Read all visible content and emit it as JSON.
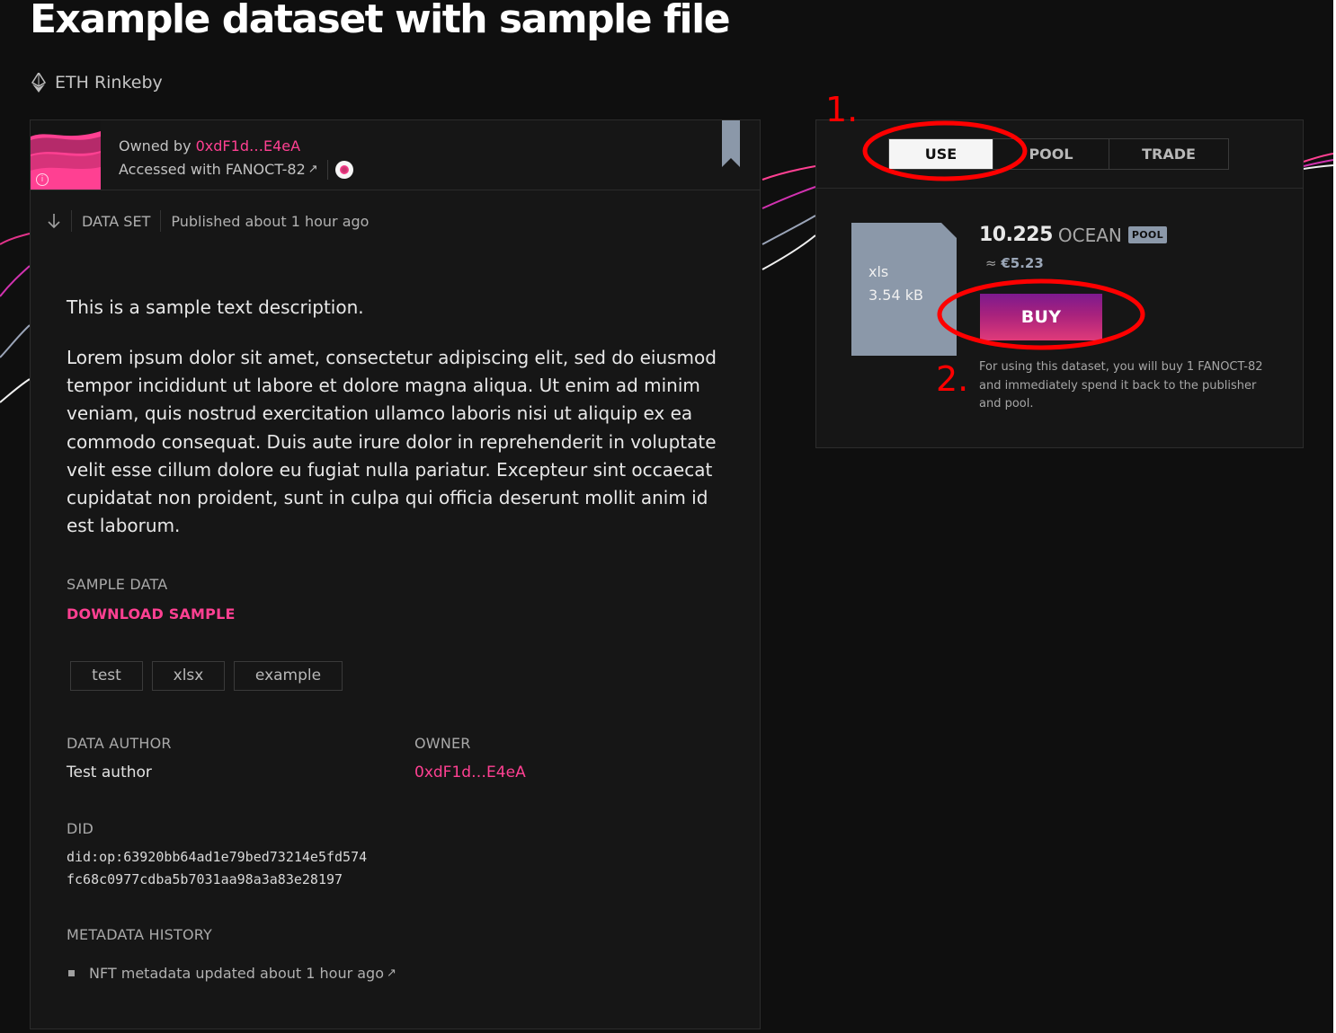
{
  "page": {
    "title": "Example dataset with sample file",
    "network": "ETH Rinkeby"
  },
  "asset": {
    "owned_by_prefix": "Owned by",
    "owner_address": "0xdF1d…E4eA",
    "accessed_with_prefix": "Accessed with",
    "datatoken": "FANOCT-82",
    "type_label": "DATA SET",
    "published": "Published about 1 hour ago",
    "description_intro": "This is a sample text description.",
    "description_body": "Lorem ipsum dolor sit amet, consectetur adipiscing elit, sed do eiusmod tempor incididunt ut labore et dolore magna aliqua. Ut enim ad minim veniam, quis nostrud exercitation ullamco laboris nisi ut aliquip ex ea commodo consequat. Duis aute irure dolor in reprehenderit in voluptate velit esse cillum dolore eu fugiat nulla pariatur. Excepteur sint occaecat cupidatat non proident, sunt in culpa qui officia deserunt mollit anim id est laborum.",
    "sample_data_label": "SAMPLE DATA",
    "download_sample": "DOWNLOAD SAMPLE",
    "tags": [
      "test",
      "xlsx",
      "example"
    ],
    "data_author_label": "DATA AUTHOR",
    "data_author": "Test author",
    "owner_label": "OWNER",
    "owner_value": "0xdF1d…E4eA",
    "did_label": "DID",
    "did_line1": "did:op:63920bb64ad1e79bed73214e5fd574",
    "did_line2": "fc68c0977cdba5b7031aa98a3a83e28197",
    "metadata_history_label": "METADATA HISTORY",
    "history_item": "NFT metadata updated about 1 hour ago"
  },
  "panel": {
    "tabs": [
      "USE",
      "POOL",
      "TRADE"
    ],
    "active_tab": "USE",
    "file_type": "xls",
    "file_size": "3.54 kB",
    "price": "10.225",
    "price_symbol": "OCEAN",
    "price_badge": "POOL",
    "fiat_prefix": "≈",
    "fiat_value": "€5.23",
    "buy_label": "BUY",
    "buy_note": "For using this dataset, you will buy 1 FANOCT-82 and immediately spend it back to the publisher and pool."
  },
  "annotations": {
    "step1": "1.",
    "step2": "2.",
    "color": "#ff0000"
  },
  "colors": {
    "accent": "#ff4092",
    "background": "#0f0f0f",
    "card": "#161616",
    "badge": "#8b98a9"
  },
  "icons": {
    "network": "ethereum-icon",
    "bookmark": "bookmark-icon",
    "type": "arrow-down-icon",
    "external": "external-link-icon",
    "info": "info-icon"
  }
}
